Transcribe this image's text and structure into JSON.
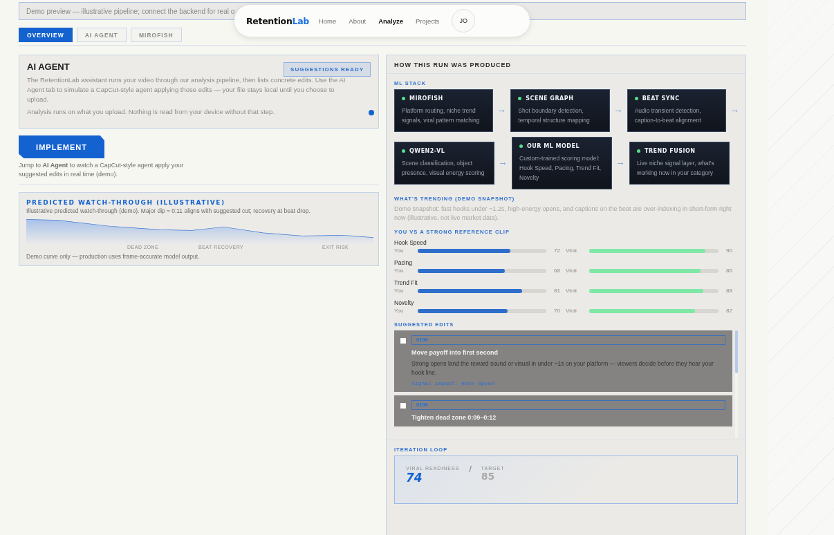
{
  "banner": {
    "text": "Demo preview — illustrative pipeline; connect the backend for real o"
  },
  "nav": {
    "logo": {
      "main": "Retention",
      "accent": "Lab"
    },
    "items": [
      {
        "label": "Home",
        "selected": false
      },
      {
        "label": "About",
        "selected": false
      },
      {
        "label": "Analyze",
        "selected": true
      },
      {
        "label": "Projects",
        "selected": false
      }
    ],
    "avatar": "JO"
  },
  "tabs": [
    {
      "label": "OVERVIEW",
      "selected": true
    },
    {
      "label": "AI AGENT",
      "selected": false
    },
    {
      "label": "MIROFISH",
      "selected": false
    }
  ],
  "agent_card": {
    "title": "AI AGENT",
    "badge": "SUGGESTIONS READY",
    "paragraphs": [
      "The RetentionLab assistant runs your video through our analysis pipeline, then lists concrete edits. Use the AI Agent tab to simulate a CapCut-style agent applying those edits — your file stays local until you choose to upload.",
      "Analysis runs on what you upload. Nothing is read from your device without that step."
    ],
    "live": true
  },
  "implement": {
    "button": "IMPLEMENT",
    "note": "Jump to **AI Agent** to watch a CapCut-style agent apply your suggested edits in real time (demo)."
  },
  "watch_through": {
    "title": "PREDICTED WATCH-THROUGH (ILLUSTRATIVE)",
    "subtitle": "Illustrative predicted watch-through (demo). Major dip ≈ 0:11 aligns with suggested cut; recovery at beat drop.",
    "markers": [
      "DEAD ZONE",
      "BEAT RECOVERY",
      "EXIT RISK"
    ],
    "footnote": "Demo curve only — production uses frame-accurate model output."
  },
  "run_panel": {
    "title": "HOW THIS RUN WAS PRODUCED",
    "ml_stack": {
      "heading": "ML STACK",
      "rows": [
        [
          {
            "name": "MIROFISH",
            "description": "Platform routing, niche trend signals, viral pattern matching"
          },
          {
            "name": "SCENE GRAPH",
            "description": "Shot boundary detection, temporal structure mapping"
          },
          {
            "name": "BEAT SYNC",
            "description": "Audio transient detection, caption-to-beat alignment"
          }
        ],
        [
          {
            "name": "QWEN2-VL",
            "description": "Scene classification, object presence, visual energy scoring"
          },
          {
            "name": "OUR ML MODEL",
            "description": "Custom-trained scoring model: Hook Speed, Pacing, Trend Fit, Novelty"
          },
          {
            "name": "TREND FUSION",
            "description": "Live niche signal layer, what's working now in your category"
          }
        ]
      ]
    },
    "trending": {
      "heading": "WHAT'S TRENDING (DEMO SNAPSHOT)",
      "text": "Demo snapshot: fast hooks under ~1.2s, high-energy opens, and captions on the beat are over-indexing in short-form right now (illustrative, not live market data)."
    },
    "comparison": {
      "heading": "YOU VS A STRONG REFERENCE CLIP",
      "metrics": [
        {
          "name": "Hook Speed",
          "you": {
            "label": "You",
            "level": 0.72,
            "value": "72"
          },
          "viral": {
            "label": "Viral",
            "level": 0.9,
            "value": "90"
          }
        },
        {
          "name": "Pacing",
          "you": {
            "label": "You",
            "level": 0.68,
            "value": "68"
          },
          "viral": {
            "label": "Viral",
            "level": 0.86,
            "value": "86"
          }
        },
        {
          "name": "Trend Fit",
          "you": {
            "label": "You",
            "level": 0.81,
            "value": "81"
          },
          "viral": {
            "label": "Viral",
            "level": 0.88,
            "value": "88"
          }
        },
        {
          "name": "Novelty",
          "you": {
            "label": "You",
            "level": 0.7,
            "value": "70"
          },
          "viral": {
            "label": "Viral",
            "level": 0.82,
            "value": "82"
          }
        }
      ]
    },
    "suggested_edits": {
      "heading": "SUGGESTED EDITS",
      "items": [
        {
          "checked": false,
          "priority": "HIGH",
          "title": "Move payoff into first second",
          "description": "Strong opens land the reward sound or visual in under ~1s on your platform — viewers decide before they hear your hook line.",
          "signal": "Signal impact: Hook Speed"
        },
        {
          "checked": false,
          "priority": "HIGH",
          "title": "Tighten dead zone 0:09–0:12"
        }
      ]
    },
    "iteration_loop": {
      "heading": "ITERATION LOOP",
      "readiness_label": "VIRAL READINESS",
      "readiness": "74",
      "separator": "/",
      "target_label": "TARGET",
      "target": "85"
    }
  }
}
